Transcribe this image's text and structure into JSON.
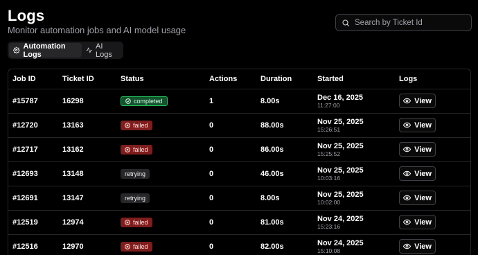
{
  "header": {
    "title": "Logs",
    "subtitle": "Monitor automation jobs and AI model usage"
  },
  "search": {
    "placeholder": "Search by Ticket Id",
    "value": ""
  },
  "tabs": [
    {
      "label": "Automation Logs",
      "icon": "gear-icon",
      "active": true
    },
    {
      "label": "AI Logs",
      "icon": "activity-icon",
      "active": false
    }
  ],
  "table": {
    "columns": [
      "Job ID",
      "Ticket ID",
      "Status",
      "Actions",
      "Duration",
      "Started",
      "Logs"
    ],
    "view_label": "View",
    "rows": [
      {
        "job_id": "#15787",
        "ticket_id": "16298",
        "status": "completed",
        "actions": "1",
        "duration": "8.00s",
        "date": "Dec 16, 2025",
        "time": "11:27:00"
      },
      {
        "job_id": "#12720",
        "ticket_id": "13163",
        "status": "failed",
        "actions": "0",
        "duration": "88.00s",
        "date": "Nov 25, 2025",
        "time": "15:26:51"
      },
      {
        "job_id": "#12717",
        "ticket_id": "13162",
        "status": "failed",
        "actions": "0",
        "duration": "86.00s",
        "date": "Nov 25, 2025",
        "time": "15:25:52"
      },
      {
        "job_id": "#12693",
        "ticket_id": "13148",
        "status": "retrying",
        "actions": "0",
        "duration": "46.00s",
        "date": "Nov 25, 2025",
        "time": "10:03:16"
      },
      {
        "job_id": "#12691",
        "ticket_id": "13147",
        "status": "retrying",
        "actions": "0",
        "duration": "8.00s",
        "date": "Nov 25, 2025",
        "time": "10:02:00"
      },
      {
        "job_id": "#12519",
        "ticket_id": "12974",
        "status": "failed",
        "actions": "0",
        "duration": "81.00s",
        "date": "Nov 24, 2025",
        "time": "15:23:16"
      },
      {
        "job_id": "#12516",
        "ticket_id": "12970",
        "status": "failed",
        "actions": "0",
        "duration": "82.00s",
        "date": "Nov 24, 2025",
        "time": "15:10:08"
      }
    ]
  },
  "colors": {
    "background": "#000000",
    "completed": "#22c55e",
    "failed": "#7f1d1d",
    "retrying": "#27272a"
  }
}
